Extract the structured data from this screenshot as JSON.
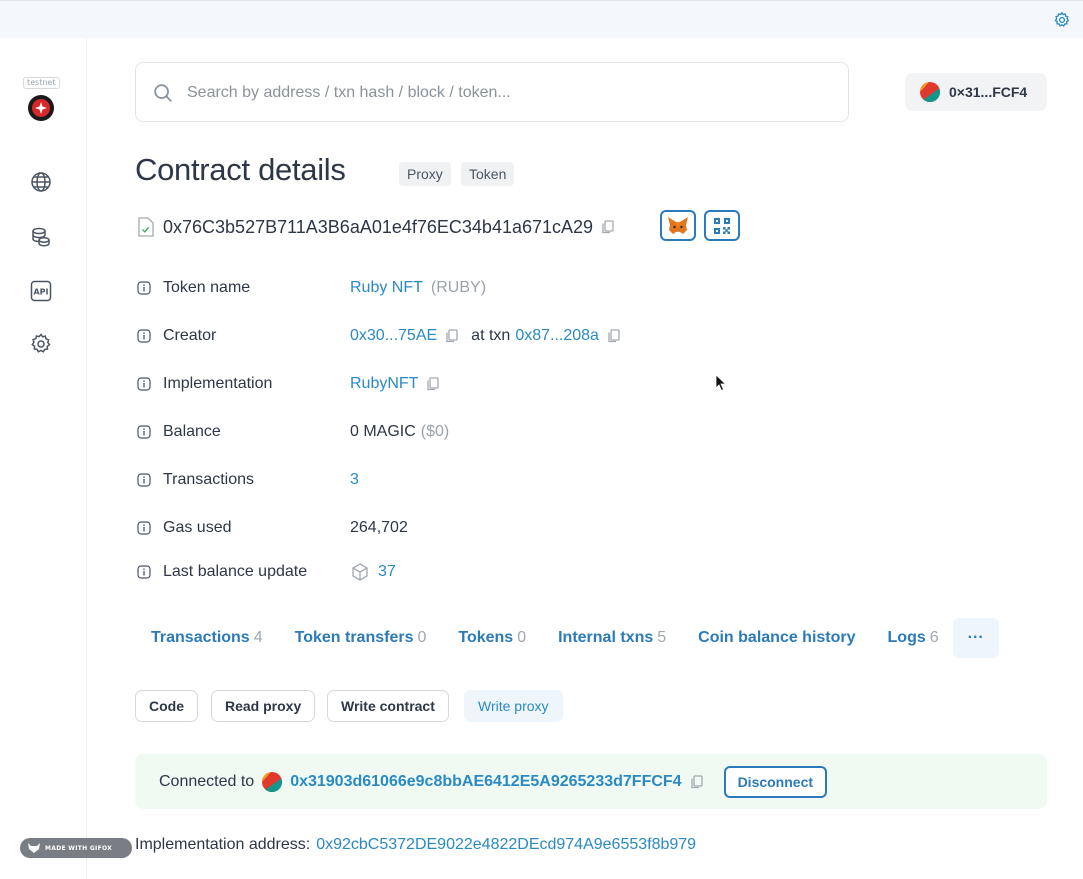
{
  "network": {
    "badge": "testnet"
  },
  "search": {
    "placeholder": "Search by address / txn hash / block / token..."
  },
  "account": {
    "short_address": "0×31...FCF4"
  },
  "page": {
    "title": "Contract details",
    "tags": [
      "Proxy",
      "Token"
    ],
    "address": "0x76C3b527B711A3B6aA01e4f76EC34b41a671cA29"
  },
  "details": {
    "token_name": {
      "label": "Token name",
      "value": "Ruby NFT",
      "symbol": "(RUBY)"
    },
    "creator": {
      "label": "Creator",
      "address": "0x30...75AE",
      "at_txn": "at txn",
      "txn": "0x87...208a"
    },
    "implementation": {
      "label": "Implementation",
      "value": "RubyNFT"
    },
    "balance": {
      "label": "Balance",
      "value": "0 MAGIC",
      "usd": "($0)"
    },
    "transactions": {
      "label": "Transactions",
      "value": "3"
    },
    "gas_used": {
      "label": "Gas used",
      "value": "264,702"
    },
    "last_balance_update": {
      "label": "Last balance update",
      "value": "37"
    }
  },
  "tabs": [
    {
      "label": "Transactions",
      "count": "4"
    },
    {
      "label": "Token transfers",
      "count": "0"
    },
    {
      "label": "Tokens",
      "count": "0"
    },
    {
      "label": "Internal txns",
      "count": "5"
    },
    {
      "label": "Coin balance history",
      "count": ""
    },
    {
      "label": "Logs",
      "count": "6"
    }
  ],
  "tab_more": "···",
  "subtabs": [
    "Code",
    "Read proxy",
    "Write contract",
    "Write proxy"
  ],
  "connection": {
    "label": "Connected to",
    "address": "0x31903d61066e9c8bbAE6412E5A9265233d7FFCF4",
    "disconnect": "Disconnect"
  },
  "implementation_address": {
    "label": "Implementation address:",
    "value": "0x92cbC5372DE9022e4822DEcd974A9e6553f8b979"
  },
  "watermark": "MADE WITH GIFOX",
  "colors": {
    "link": "#2b8ac4",
    "accent": "#2b7ab9",
    "connected_bg": "#f0faf3"
  }
}
